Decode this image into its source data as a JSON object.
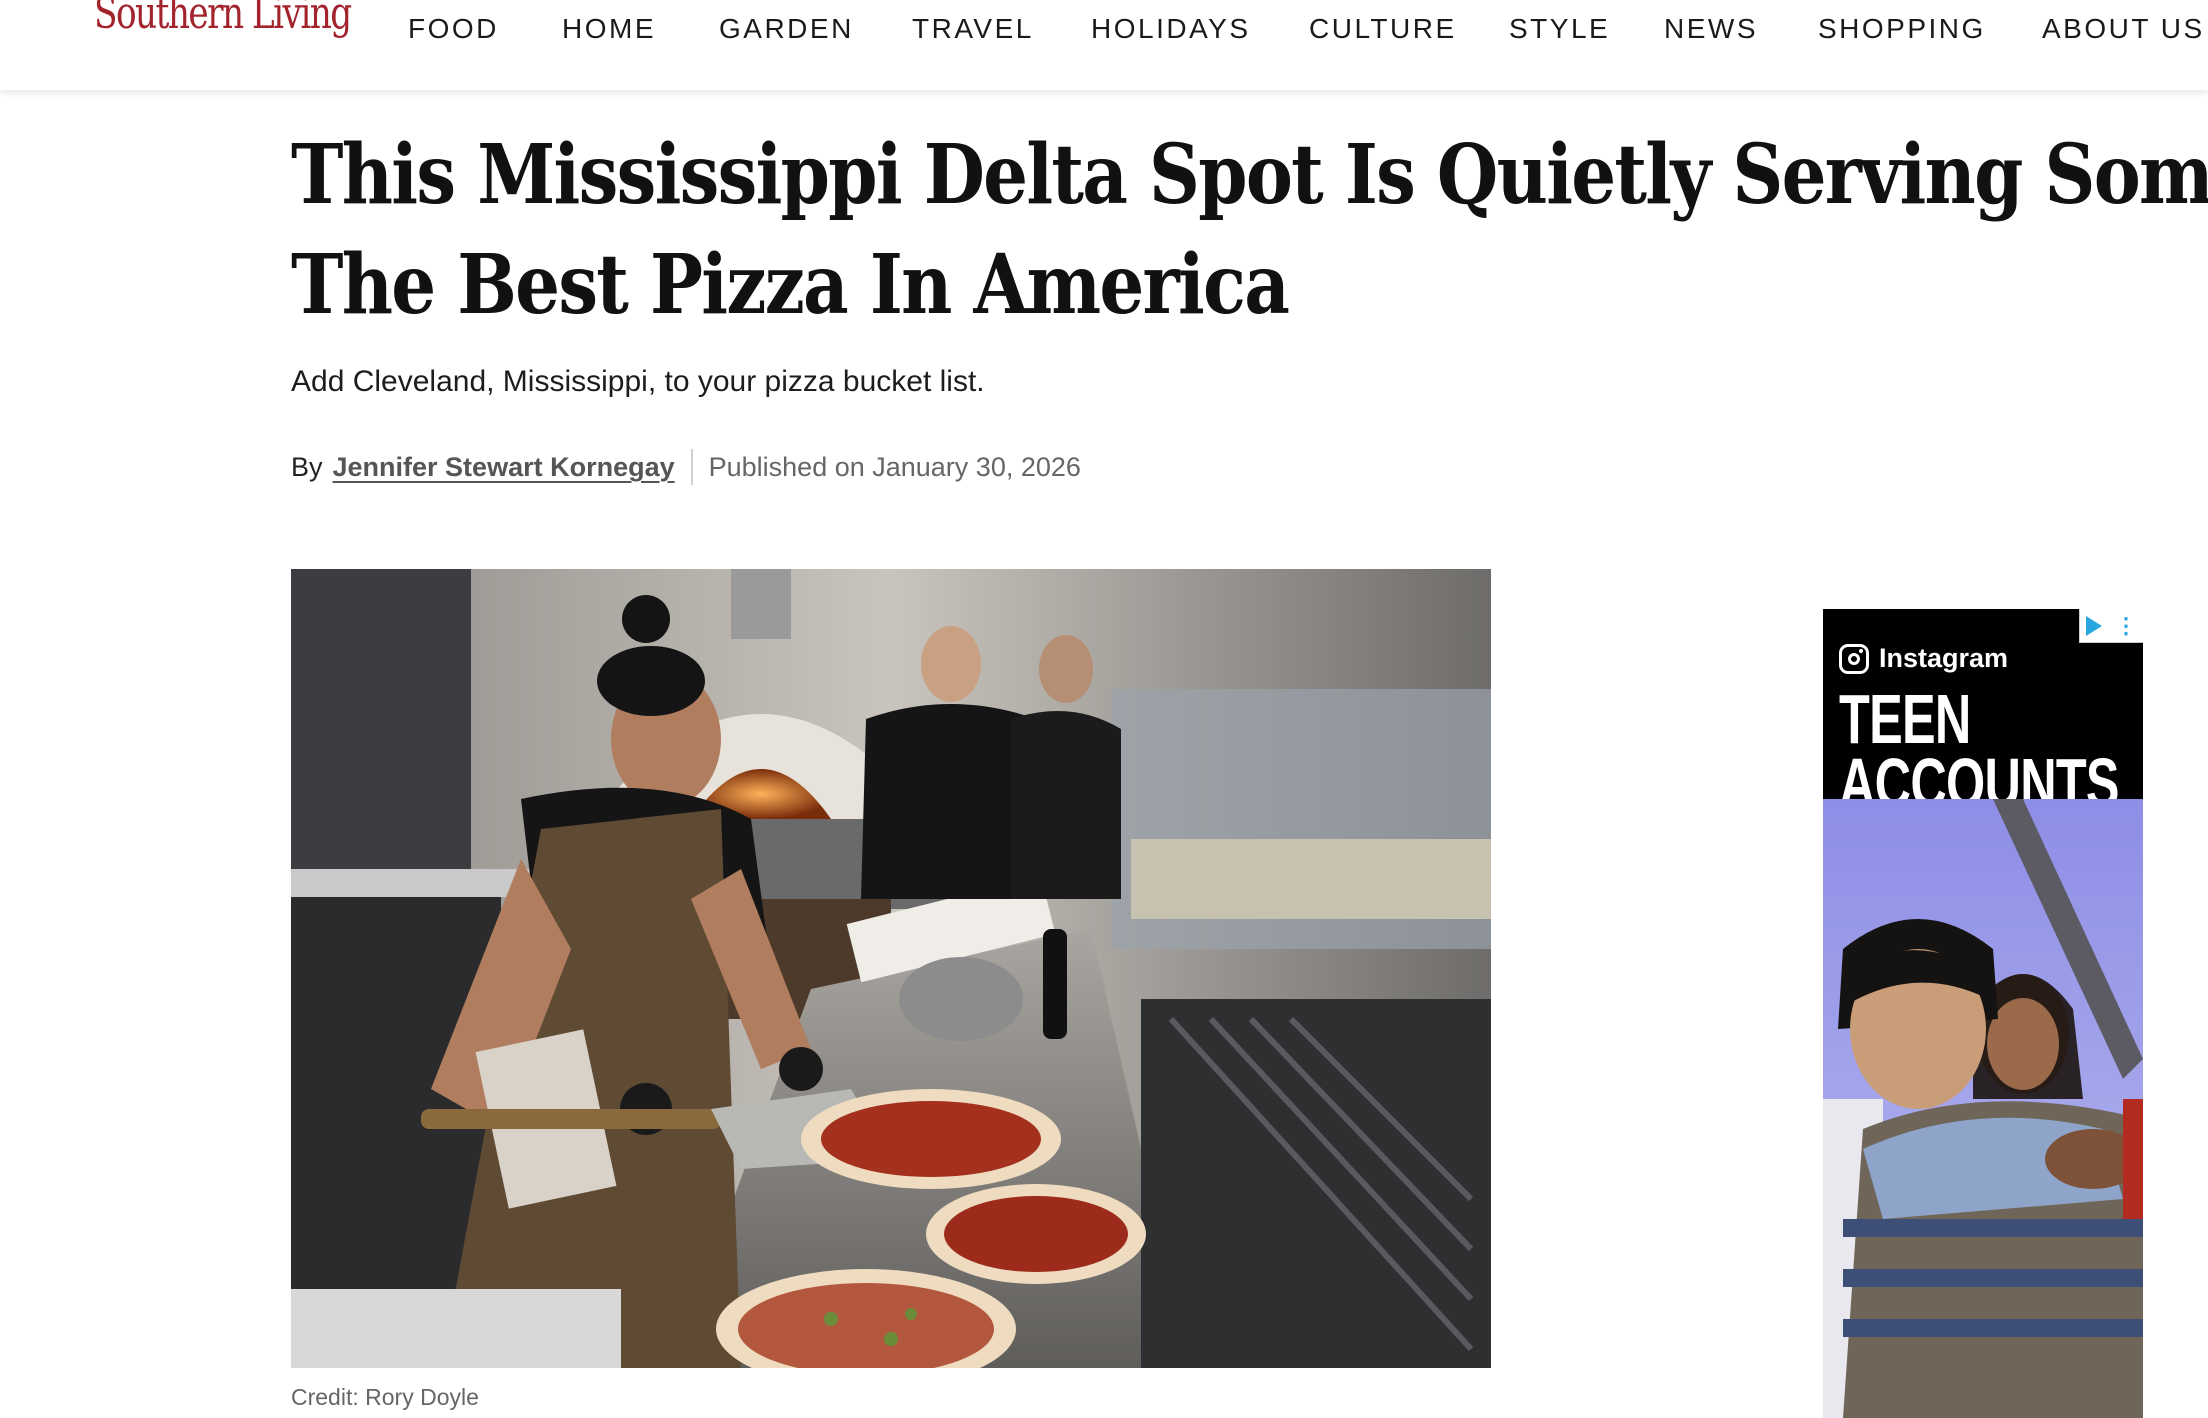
{
  "site": {
    "logo": "Southern Living",
    "brand_color": "#a3232d"
  },
  "nav": {
    "items": [
      "FOOD",
      "HOME",
      "GARDEN",
      "TRAVEL",
      "HOLIDAYS",
      "CULTURE",
      "STYLE",
      "NEWS",
      "SHOPPING",
      "ABOUT US"
    ]
  },
  "article": {
    "headline_line1": "This Mississippi Delta Spot Is Quietly Serving Some Of",
    "headline_line2": "The Best Pizza In America",
    "dek": "Add Cleveland, Mississippi, to your pizza bucket list.",
    "byline_prefix": "By",
    "author": "Jennifer Stewart Kornegay",
    "published": "Published on January 30, 2026",
    "image_credit": "Credit: Rory Doyle"
  },
  "ad": {
    "brand": "Instagram",
    "headline_line1": "TEEN",
    "headline_line2": "ACCOUNTS",
    "ad_choices_icon": "ad-choices-icon",
    "ad_choices_color": "#29a6e0"
  }
}
